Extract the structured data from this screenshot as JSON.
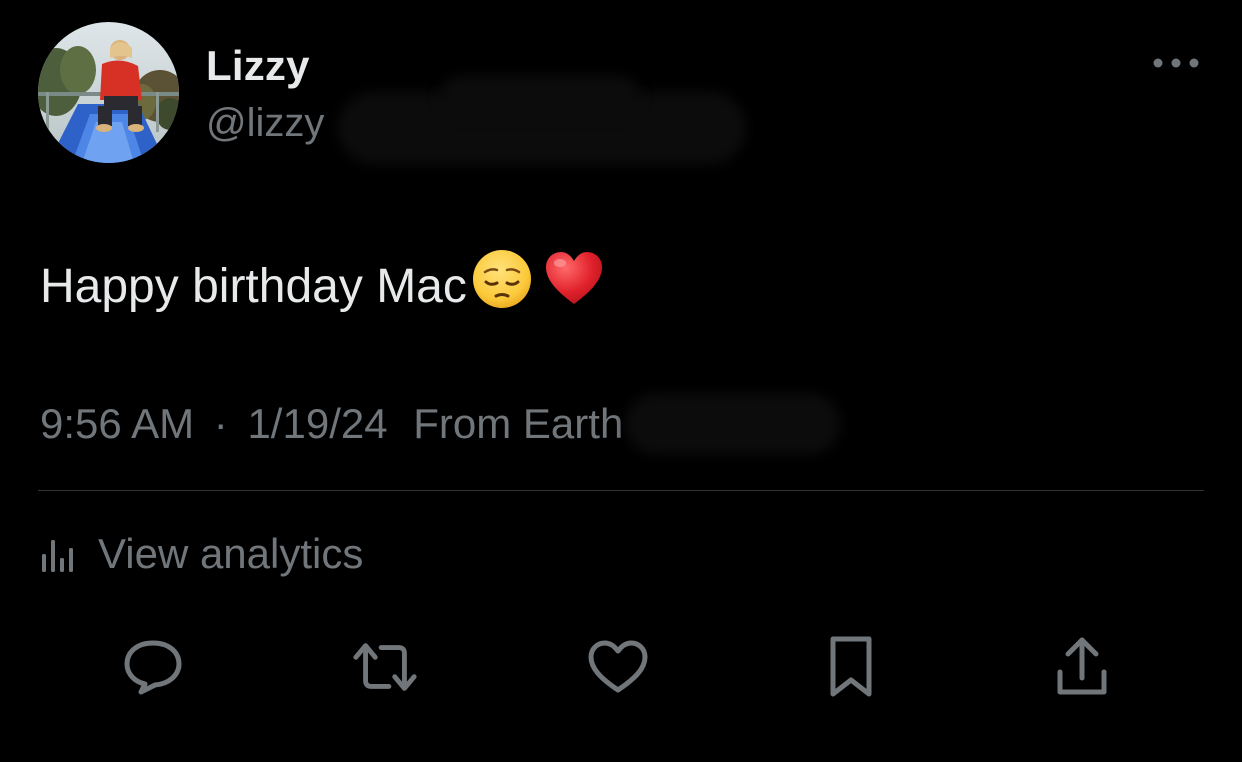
{
  "user": {
    "display_name": "Lizzy",
    "handle": "@lizzy"
  },
  "tweet": {
    "text": "Happy birthday Mac",
    "emojis": [
      "pensive-face",
      "red-heart"
    ],
    "time": "9:56 AM",
    "separator": "·",
    "date": "1/19/24",
    "location": "From Earth"
  },
  "analytics": {
    "label": "View analytics"
  },
  "actions": [
    {
      "name": "reply",
      "icon": "speech-bubble-icon"
    },
    {
      "name": "repost",
      "icon": "repost-arrows-icon"
    },
    {
      "name": "like",
      "icon": "heart-icon"
    },
    {
      "name": "bookmark",
      "icon": "bookmark-icon"
    },
    {
      "name": "share",
      "icon": "share-upload-icon"
    }
  ],
  "colors": {
    "background": "#000000",
    "primary_text": "#e7e9ea",
    "secondary_text": "#71767b",
    "divider": "#2f3336",
    "heart_emoji": "#e0212b"
  }
}
